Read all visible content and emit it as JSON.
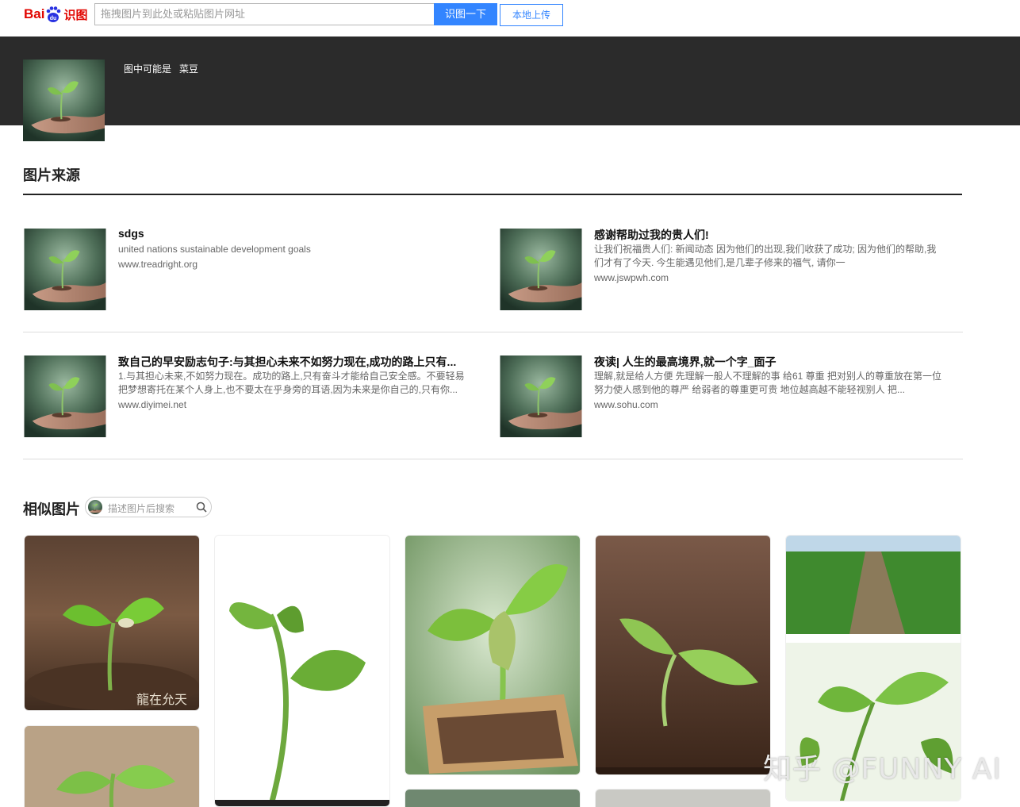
{
  "header": {
    "logo_bai": "Bai",
    "logo_du": "du",
    "logo_shitu": "识图",
    "search_placeholder": "拖拽图片到此处或粘贴图片网址",
    "search_button": "识图一下",
    "upload_button": "本地上传"
  },
  "result": {
    "guess_prefix": "图中可能是",
    "guess_value": "菜豆"
  },
  "sources": {
    "title": "图片来源",
    "items": [
      {
        "title": "sdgs",
        "desc": "united nations sustainable development goals",
        "url": "www.treadright.org"
      },
      {
        "title": "感谢帮助过我的贵人们!",
        "desc": "让我们祝福贵人们: 新闻动态 因为他们的出现,我们收获了成功; 因为他们的帮助,我们才有了今天. 今生能遇见他们,是几辈子修来的福气, 请你一",
        "url": "www.jswpwh.com"
      },
      {
        "title": "致自己的早安励志句子:与其担心未来不如努力现在,成功的路上只有...",
        "desc": "1.与其担心未来,不如努力现在。成功的路上,只有奋斗才能给自己安全感。不要轻易把梦想寄托在某个人身上,也不要太在乎身旁的耳语,因为未来是你自己的,只有你...",
        "url": "www.diyimei.net"
      },
      {
        "title": "夜读| 人生的最高境界,就一个字_面子",
        "desc": "理解,就是给人方便 先理解一般人不理解的事 给61 尊重 把对别人的尊重放在第一位 努力使人感到他的尊严 给弱者的尊重更可贵 地位越高越不能轻视别人 把...",
        "url": "www.sohu.com"
      }
    ]
  },
  "similar": {
    "title": "相似图片",
    "search_placeholder": "描述图片后搜索",
    "caption_1": "龍在允天"
  },
  "watermark": "知乎 @FUNNY AI",
  "colors": {
    "accent": "#3385ff",
    "band": "#2b2b2b",
    "brand_red": "#e10601",
    "brand_blue": "#2932e1"
  }
}
